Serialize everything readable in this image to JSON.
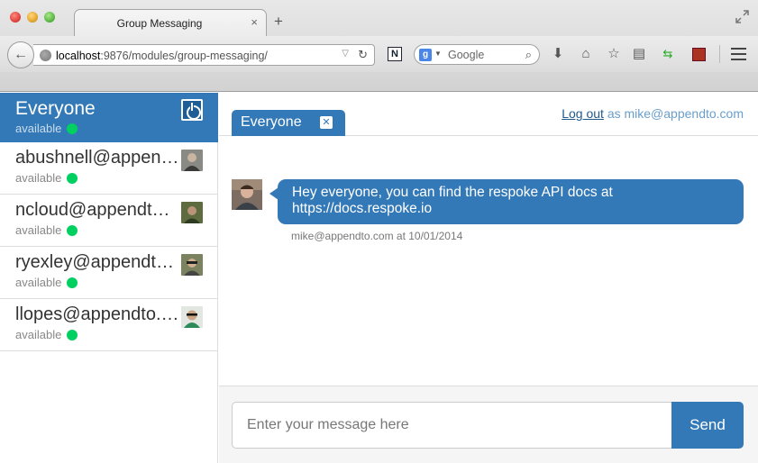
{
  "browser": {
    "tab_title": "Group Messaging",
    "tab_close": "×",
    "new_tab": "+",
    "url_host": "localhost",
    "url_path": ":9876/modules/group-messaging/",
    "search_engine_label": "Google",
    "icons": [
      "back-arrow-icon",
      "globe-icon",
      "reload-icon",
      "n-extension-icon",
      "google-icon",
      "search-icon",
      "download-icon",
      "home-icon",
      "bookmark-star-icon",
      "reading-list-icon",
      "sync-arrows-icon",
      "extension-icon",
      "menu-icon",
      "fullscreen-icon"
    ]
  },
  "sidebar": {
    "group": {
      "name": "Everyone",
      "status": "available"
    },
    "users": [
      {
        "name": "abushnell@appendto.com",
        "status": "available"
      },
      {
        "name": "ncloud@appendto.com",
        "status": "available"
      },
      {
        "name": "ryexley@appendto.com",
        "status": "available"
      },
      {
        "name": "llopes@appendto.com",
        "status": "available"
      }
    ]
  },
  "conversation": {
    "tab_label": "Everyone",
    "tab_close": "✕",
    "logout_link": "Log out",
    "logged_in_as": "as mike@appendto.com",
    "messages": [
      {
        "text": "Hey everyone, you can find the respoke API docs at https://docs.respoke.io",
        "meta": "mike@appendto.com at 10/01/2014"
      }
    ]
  },
  "composer": {
    "placeholder": "Enter your message here",
    "value": "",
    "send_label": "Send"
  },
  "colors": {
    "accent": "#3479b7",
    "presence_online": "#00d060"
  }
}
